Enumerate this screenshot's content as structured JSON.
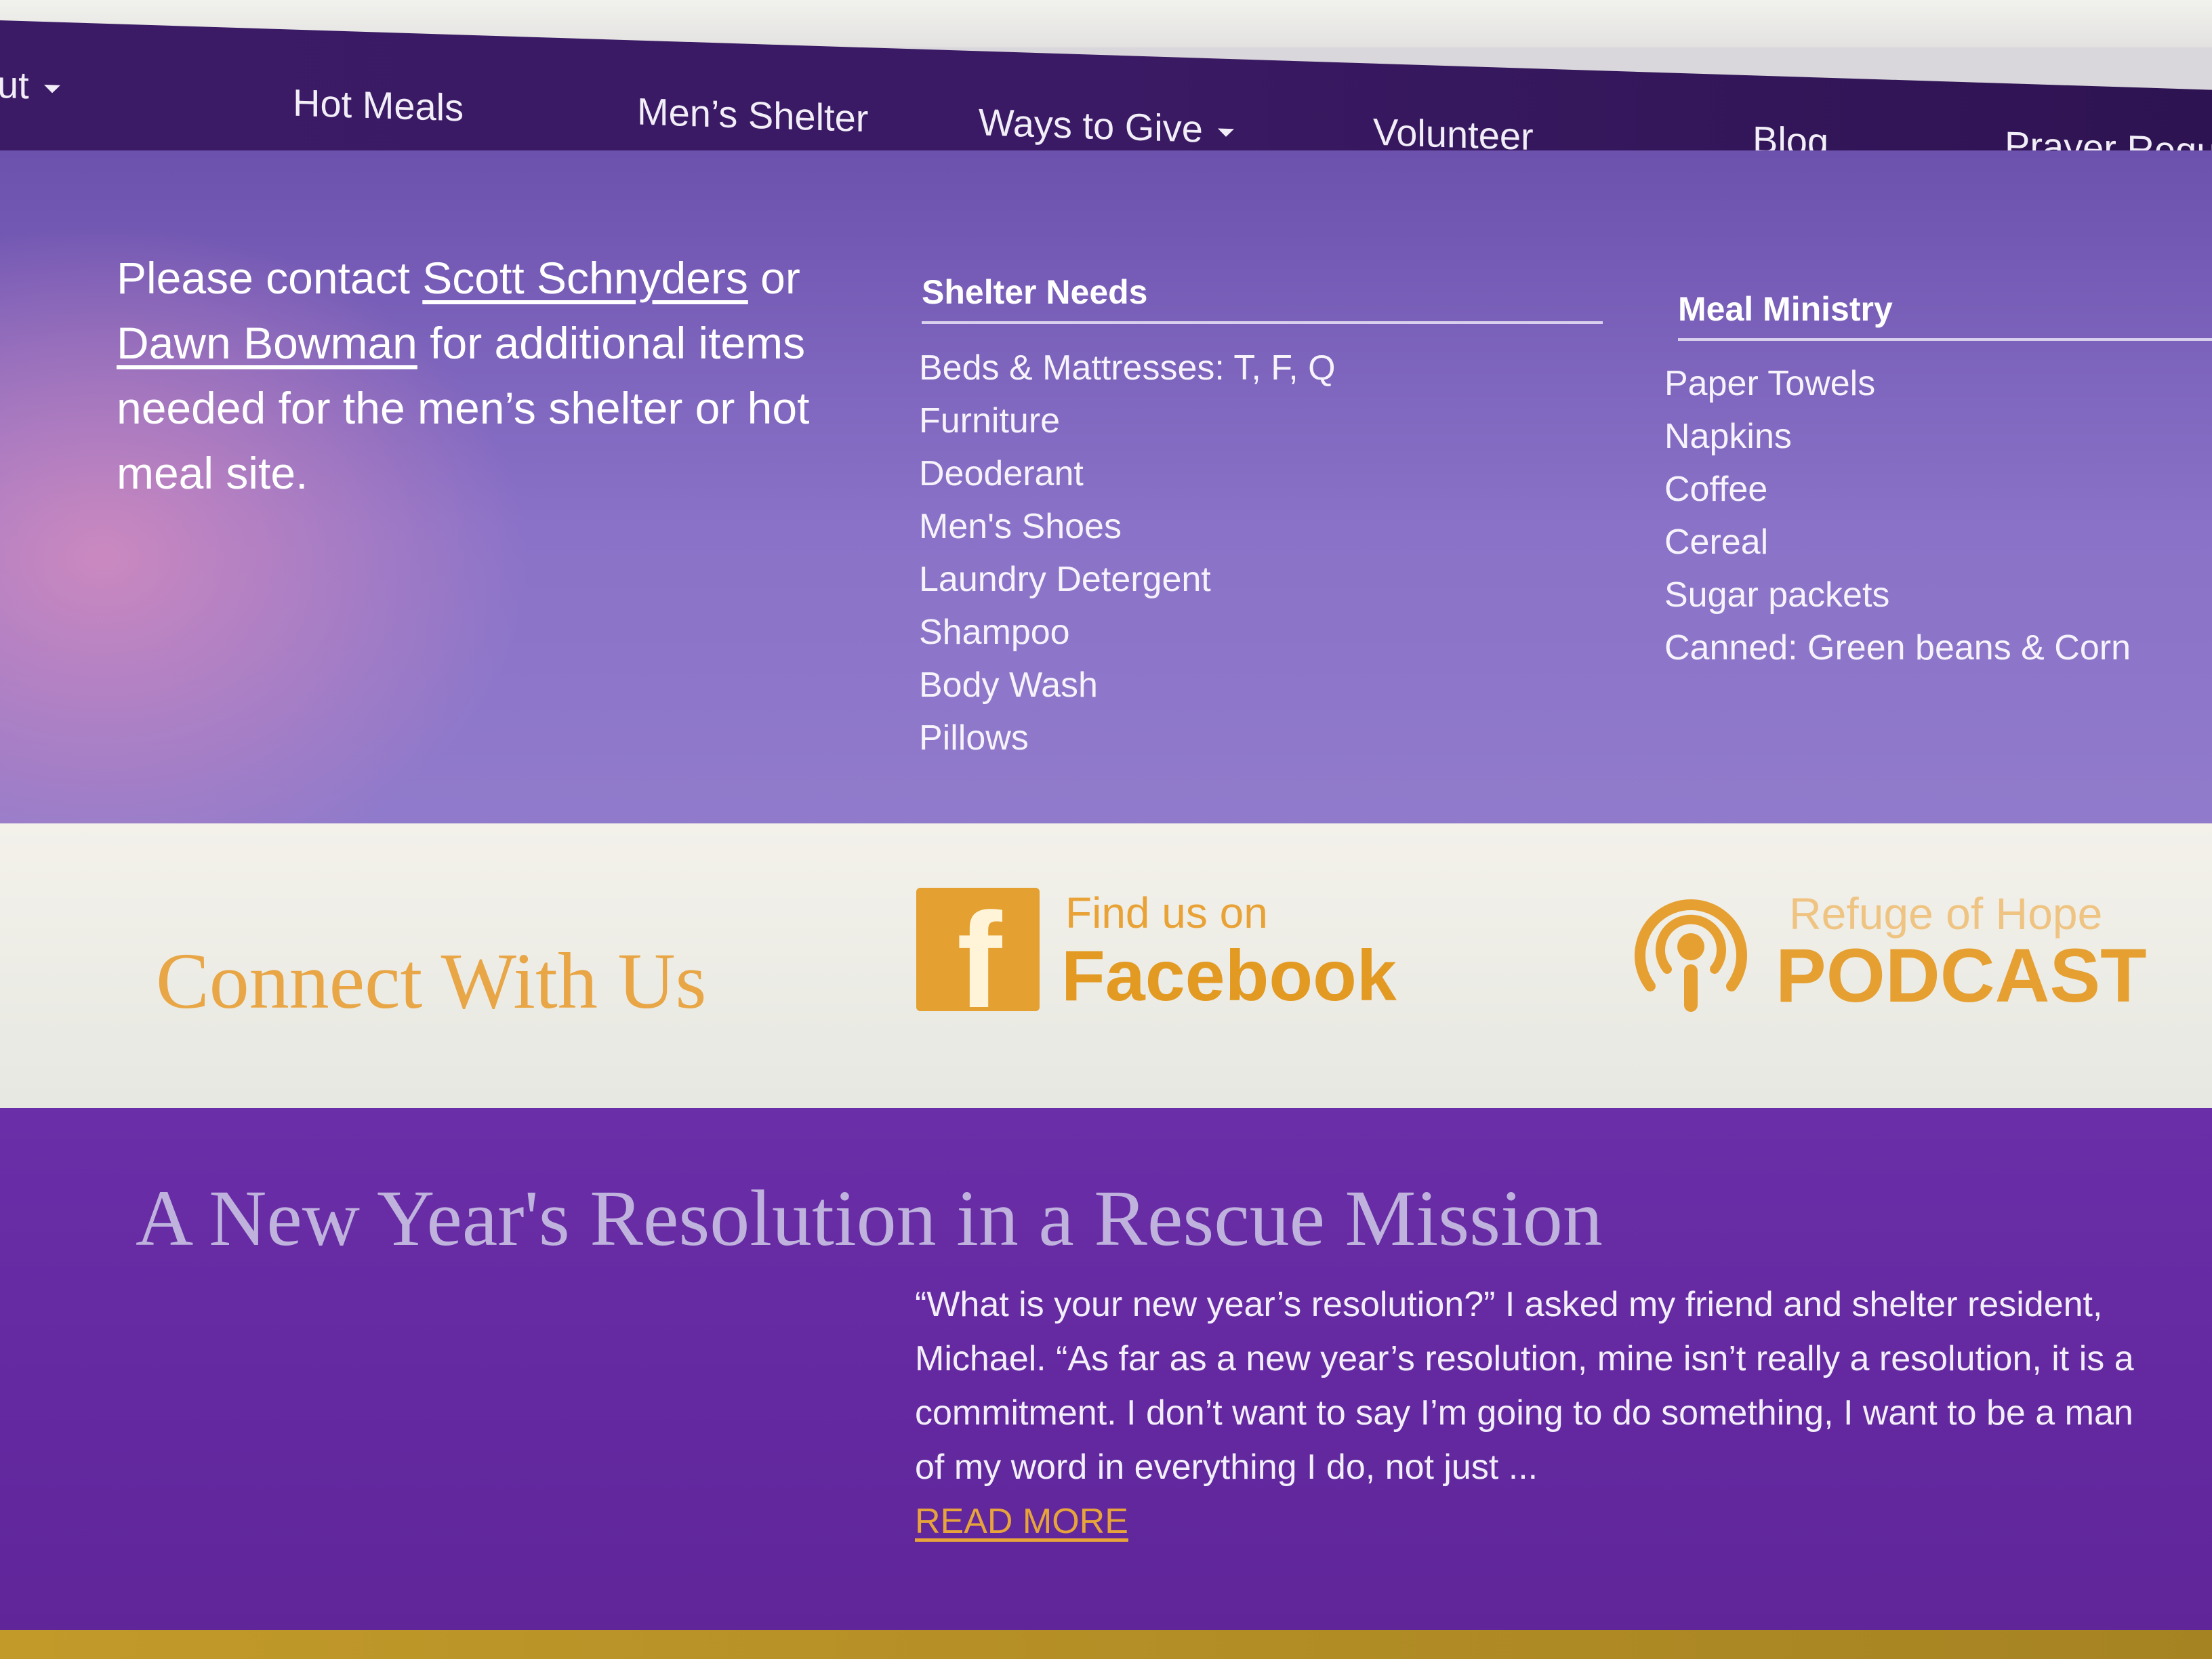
{
  "nav": {
    "items": [
      {
        "label": "ut",
        "caret": true
      },
      {
        "label": "Hot Meals",
        "caret": false
      },
      {
        "label": "Men’s Shelter",
        "caret": false
      },
      {
        "label": "Ways to Give",
        "caret": true
      },
      {
        "label": "Volunteer",
        "caret": false
      },
      {
        "label": "Blog",
        "caret": false
      },
      {
        "label": "Prayer Reques",
        "caret": false
      }
    ]
  },
  "needs": {
    "contact": {
      "prefix": "Please contact ",
      "link1": "Scott Schnyders",
      "middle": " or ",
      "link2": "Dawn Bowman",
      "suffix": " for additional items needed for the men’s shelter or hot meal site."
    },
    "shelter": {
      "heading": "Shelter Needs",
      "items": [
        "Beds & Mattresses: T, F, Q",
        "Furniture",
        "Deoderant",
        "Men's Shoes",
        "Laundry Detergent",
        "Shampoo",
        "Body Wash",
        "Pillows"
      ]
    },
    "meal": {
      "heading": "Meal Ministry",
      "items": [
        "Paper Towels",
        "Napkins",
        "Coffee",
        "Cereal",
        "Sugar packets",
        "Canned: Green beans & Corn"
      ]
    }
  },
  "connect": {
    "title": "Connect With Us",
    "facebook_small": "Find us on",
    "facebook_big": "Facebook",
    "podcast_small": "Refuge of Hope",
    "podcast_big": "PODCAST"
  },
  "blog": {
    "title": "A New Year's Resolution in a Rescue Mission",
    "excerpt": "“What is your new year’s resolution?” I asked my friend and shelter resident, Michael. “As far as a new year’s resolution, mine isn’t really a resolution, it is a commitment. I don’t want to say I’m going to do something, I want to be a man of my word in everything I do, not just ...",
    "read_more": "READ MORE"
  },
  "colors": {
    "nav_bg": "#3b1a66",
    "needs_bg": "#8a72c8",
    "accent_gold": "#e6a032",
    "blog_bg": "#6a2ea8"
  }
}
